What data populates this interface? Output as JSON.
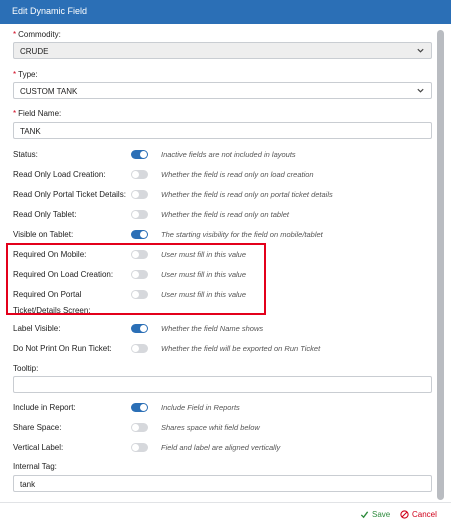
{
  "window": {
    "title": "Edit Dynamic Field"
  },
  "commodity": {
    "label": "Commodity:",
    "value": "CRUDE"
  },
  "type": {
    "label": "Type:",
    "value": "CUSTOM TANK"
  },
  "field_name": {
    "label": "Field Name:",
    "value": "TANK"
  },
  "rows": [
    {
      "label": "Status:",
      "on": true,
      "desc": "Inactive fields are not included in layouts"
    },
    {
      "label": "Read Only Load Creation:",
      "on": false,
      "desc": "Whether the field is read only on load creation"
    },
    {
      "label": "Read Only Portal Ticket Details:",
      "on": false,
      "desc": "Whether the field is read only on portal ticket details"
    },
    {
      "label": "Read Only Tablet:",
      "on": false,
      "desc": "Whether the field is read only on tablet"
    },
    {
      "label": "Visible on Tablet:",
      "on": true,
      "desc": "The starting visibility for the field on mobile/tablet"
    },
    {
      "label": "Required On Mobile:",
      "on": false,
      "desc": "User must fill in this value"
    },
    {
      "label": "Required On Load Creation:",
      "on": false,
      "desc": "User must fill in this value"
    },
    {
      "label": "Required On Portal",
      "on": false,
      "desc": "User must fill in this value"
    },
    {
      "label": "Ticket/Details Screen:"
    },
    {
      "label": "Label Visible:",
      "on": true,
      "desc": "Whether the field Name shows"
    },
    {
      "label": "Do Not Print On Run Ticket:",
      "on": false,
      "desc": "Whether the field will be exported on Run Ticket"
    }
  ],
  "tooltip": {
    "label": "Tooltip:",
    "value": ""
  },
  "rows2": [
    {
      "label": "Include in Report:",
      "on": true,
      "desc": "Include Field in Reports"
    },
    {
      "label": "Share Space:",
      "on": false,
      "desc": "Shares space whit field below"
    },
    {
      "label": "Vertical Label:",
      "on": false,
      "desc": "Field and label are aligned vertically"
    }
  ],
  "internal_tag": {
    "label": "Internal Tag:",
    "value": "tank"
  },
  "footer": {
    "save": "Save",
    "cancel": "Cancel"
  },
  "colors": {
    "accent": "#2b6fb6",
    "required": "#d0021b",
    "highlight": "#e3001b",
    "save": "#2e8b3d"
  }
}
